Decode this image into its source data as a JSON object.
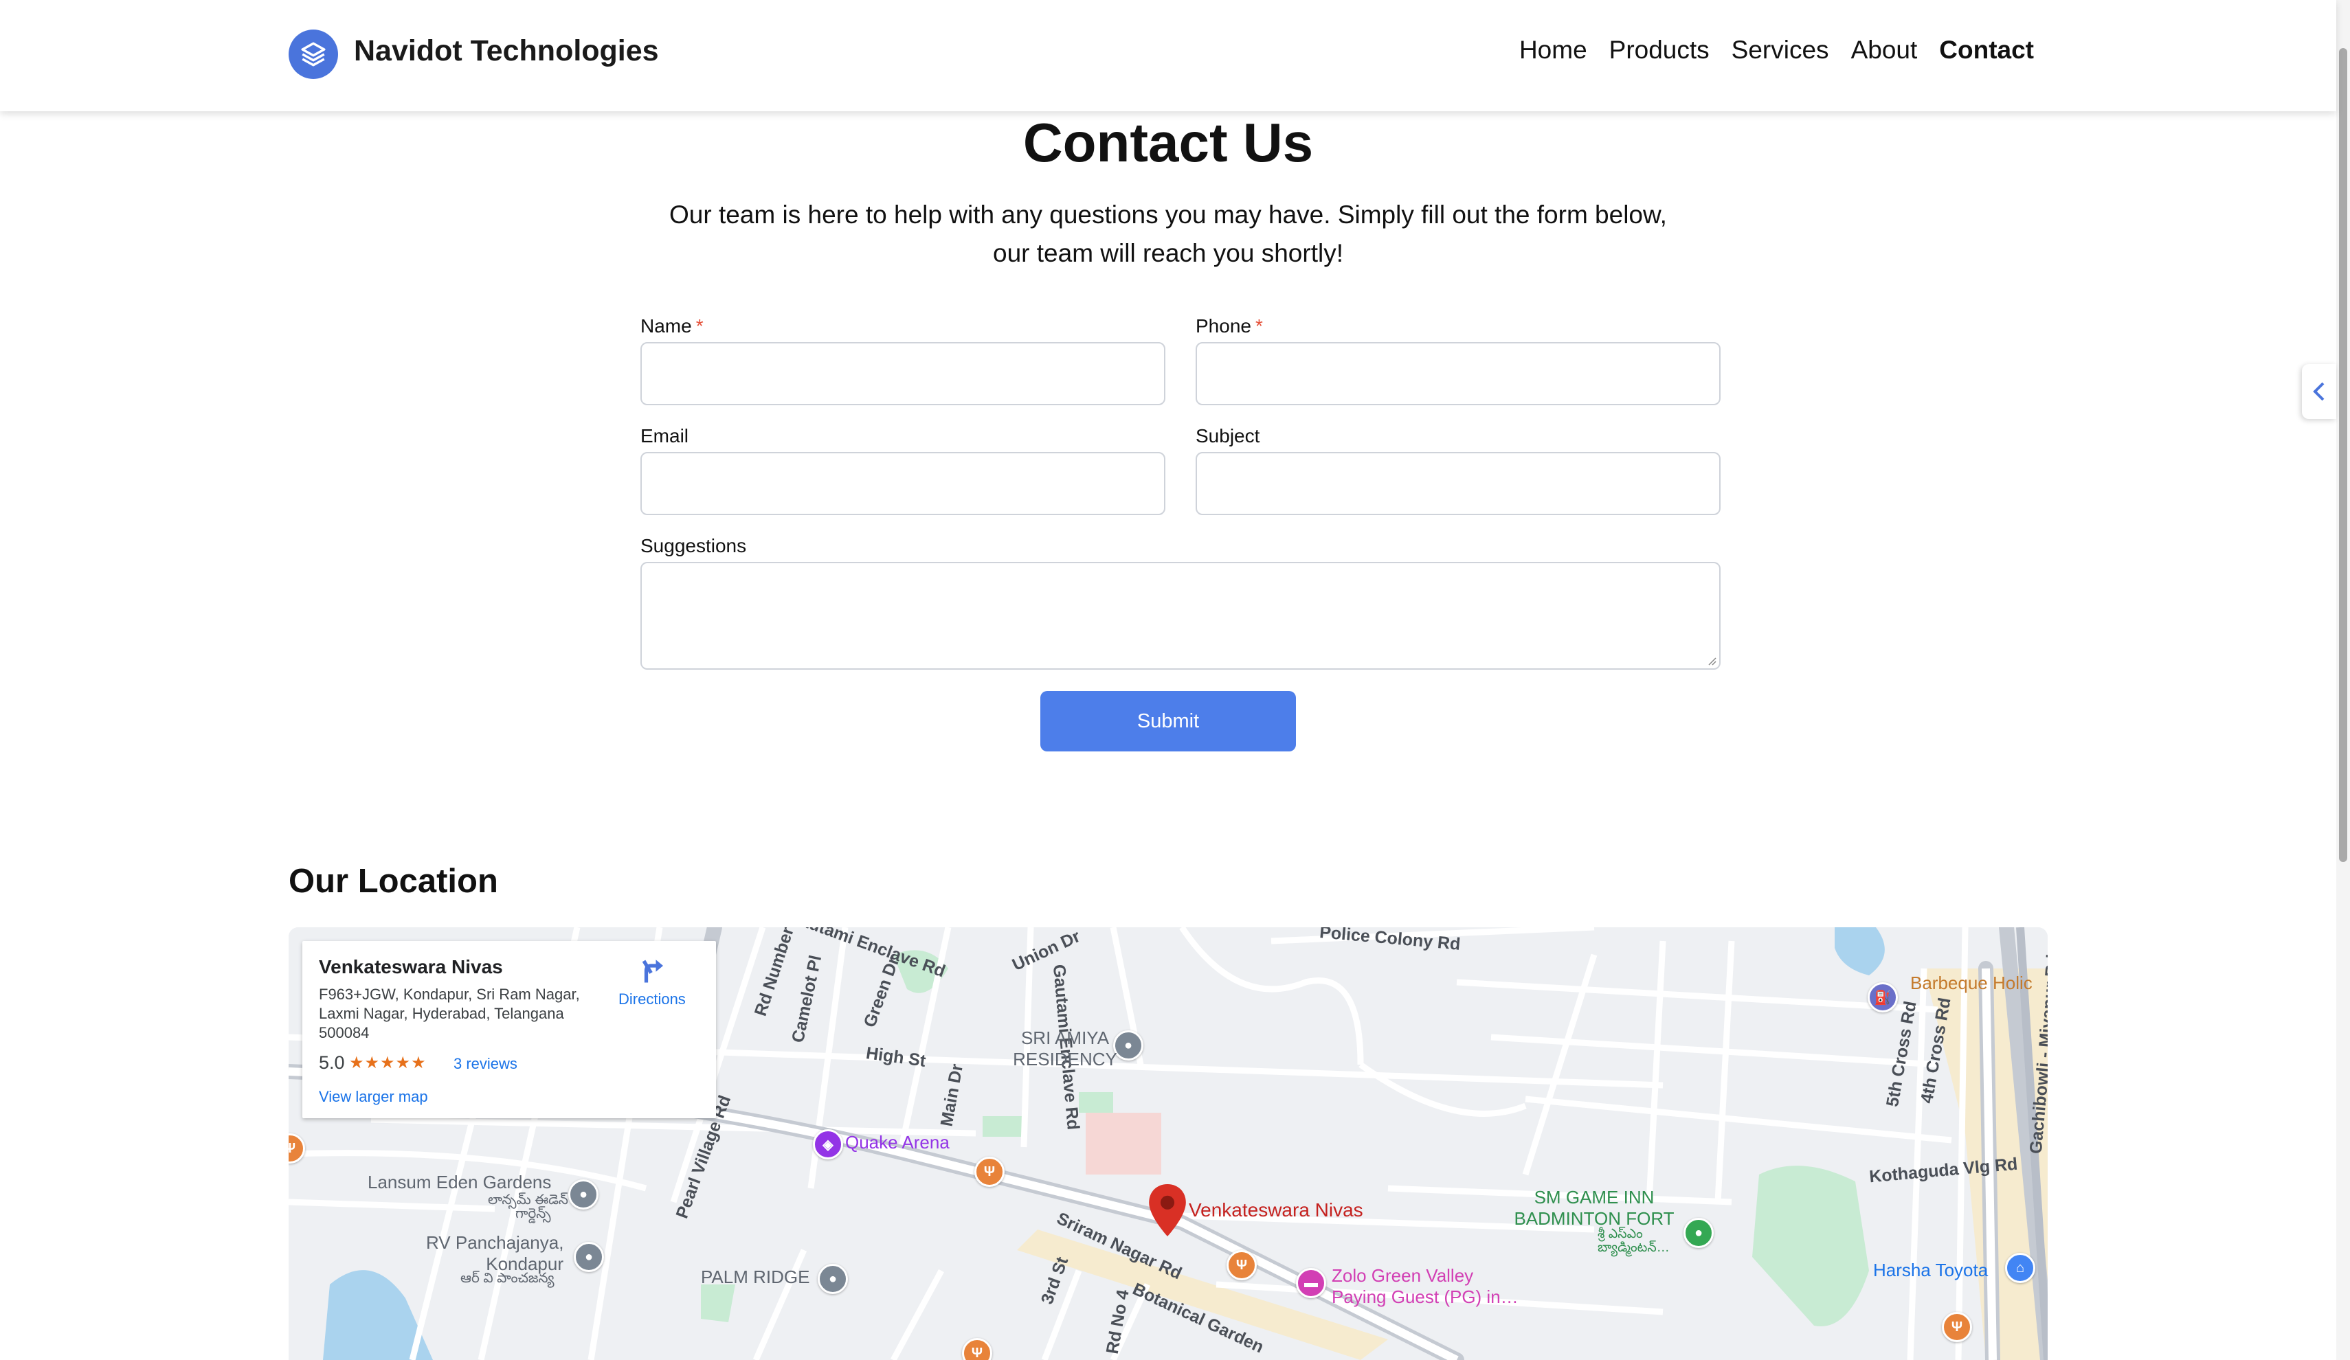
{
  "header": {
    "brand": "Navidot Technologies",
    "nav": [
      "Home",
      "Products",
      "Services",
      "About",
      "Contact"
    ],
    "active_nav": "Contact"
  },
  "contact": {
    "title": "Contact Us",
    "subtitle": "Our team is here to help with any questions you may have. Simply fill out the form below, our team will reach you shortly!",
    "required_mark": "*",
    "fields": {
      "name": {
        "label": "Name",
        "value": ""
      },
      "phone": {
        "label": "Phone",
        "value": ""
      },
      "email": {
        "label": "Email",
        "value": ""
      },
      "subject": {
        "label": "Subject",
        "value": ""
      },
      "suggestions": {
        "label": "Suggestions",
        "value": ""
      }
    },
    "submit_label": "Submit"
  },
  "location": {
    "heading": "Our Location",
    "card": {
      "title": "Venkateswara Nivas",
      "address": "F963+JGW, Kondapur, Sri Ram Nagar, Laxmi Nagar, Hyderabad, Telangana 500084",
      "rating": "5.0",
      "stars": "★★★★★",
      "reviews": "3 reviews",
      "larger_map": "View larger map",
      "directions": "Directions"
    },
    "places": {
      "marker": "Venkateswara Nivas",
      "quake": "Quake Arena",
      "amiya_1": "SRI AMIYA",
      "amiya_2": "RESIDENCY",
      "lansum": "Lansum Eden Gardens",
      "lansum_te_1": "లాన్సమ్ ఈడెన్",
      "lansum_te_2": "గార్డెన్స్",
      "rv_1": "RV Panchajanya,",
      "rv_2": "Kondapur",
      "rv_te": "ఆర్ వి పాంచజన్య",
      "palm": "PALM RIDGE",
      "zolo_1": "Zolo Green Valley",
      "zolo_2": "Paying Guest (PG) in…",
      "smgame_1": "SM GAME INN",
      "smgame_2": "BADMINTON FORT",
      "smgame_te": "బ్యాడ్మింటన్…",
      "harsha": "Harsha Toyota",
      "barbeque": "Barbeque Holic",
      "te_small": "శ్రీ ఎస్ఎం"
    },
    "roads": {
      "gautami_enclave": "Gautami Enclave Rd",
      "union": "Union Dr",
      "police_colony": "Police Colony Rd",
      "rd_number": "Rd Number",
      "camelot": "Camelot Pl",
      "green_dr": "Green Dr",
      "high_st": "High St",
      "main_dr": "Main Dr",
      "gautami_enclave_2": "Gautami Enclave Rd",
      "pearl_village": "Pearl Village Rd",
      "sriram_nagar": "Sriram Nagar Rd",
      "third_st": "3rd St",
      "rd_no_4": "Rd No 4",
      "botanical": "Botanical Garden",
      "fifth_cross": "5th Cross Rd",
      "fourth_cross": "4th Cross Rd",
      "kothaguda": "Kothaguda Vlg Rd",
      "gachibowli": "Gachibowli - Miyapur Rd"
    }
  },
  "colors": {
    "accent": "#4d7eea",
    "logo": "#4a74dc",
    "required": "#e5533c",
    "map_marker": "#d93025",
    "poi_purple": "#9334e6",
    "poi_orange": "#e8833a",
    "poi_gray": "#7b8794",
    "poi_green": "#34a853",
    "poi_blue": "#4285f4",
    "poi_pink": "#d23fb4"
  },
  "icons": {
    "logo": "layers-icon",
    "side_tab": "chevron-left-icon",
    "directions": "directions-arrow-icon",
    "map_marker": "map-pin-icon"
  }
}
